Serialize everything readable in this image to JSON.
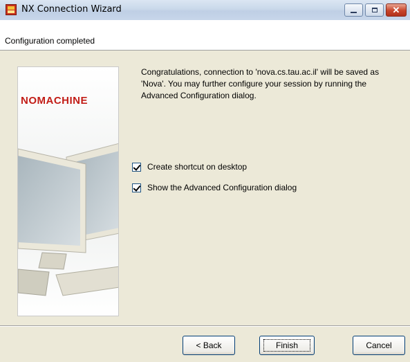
{
  "window": {
    "title": "NX Connection Wizard",
    "icon": "nx-app-icon"
  },
  "header": {
    "subtitle": "Configuration completed"
  },
  "sidebar_image": {
    "brand_text": "NOMACHINE",
    "brand_color": "#c21d17"
  },
  "message": "Congratulations, connection to 'nova.cs.tau.ac.il' will be saved as 'Nova'. You may further configure your session by running the Advanced Configuration dialog.",
  "options": [
    {
      "label": "Create shortcut on desktop",
      "checked": true
    },
    {
      "label": "Show the Advanced Configuration dialog",
      "checked": true
    }
  ],
  "buttons": {
    "back": "< Back",
    "finish": "Finish",
    "cancel": "Cancel"
  }
}
